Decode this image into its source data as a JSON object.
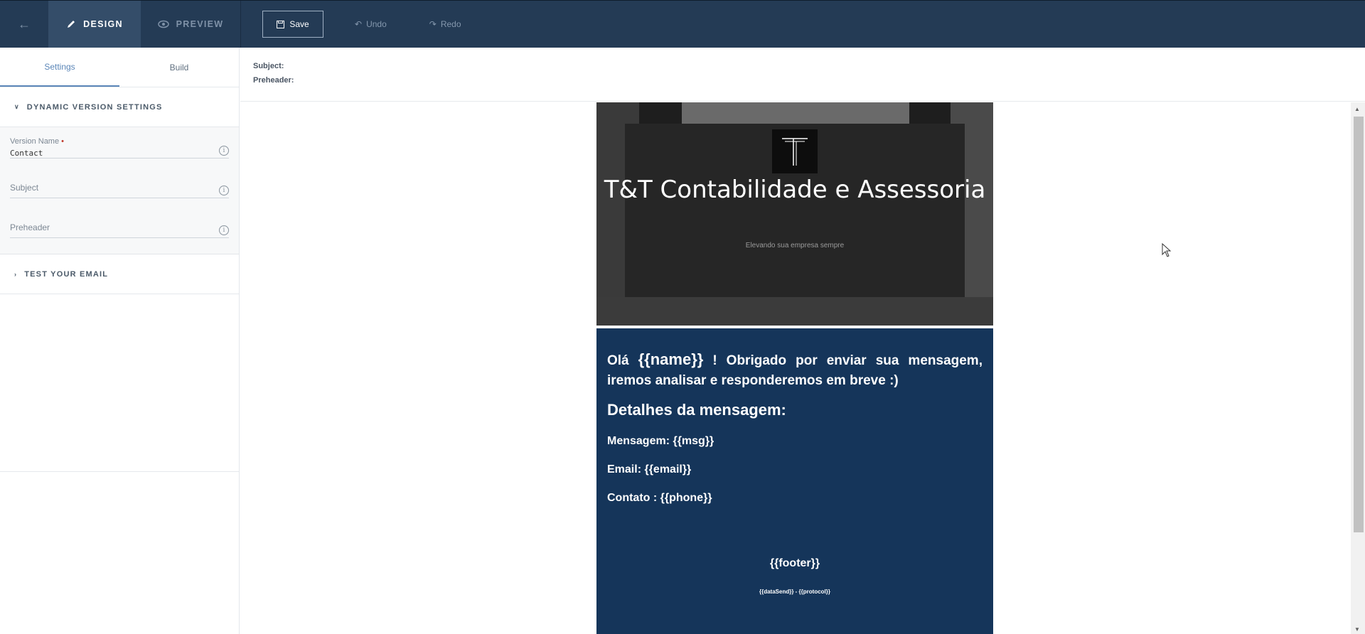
{
  "topbar": {
    "back_icon": "arrow-left-icon",
    "tab_design": "DESIGN",
    "tab_preview": "PREVIEW",
    "save_label": "Save",
    "undo_label": "Undo",
    "redo_label": "Redo"
  },
  "sidebar": {
    "tabs": [
      "Settings",
      "Build"
    ],
    "panel_dynamic": "DYNAMIC VERSION SETTINGS",
    "fields": {
      "version_name_label": "Version Name",
      "version_name_value": "Contact",
      "subject_label": "Subject",
      "preheader_label": "Preheader"
    },
    "panel_test": "TEST YOUR EMAIL"
  },
  "meta": {
    "subject_label": "Subject:",
    "preheader_label": "Preheader:"
  },
  "email": {
    "hero_title": "T&T Contabilidade e Assessoria",
    "hero_subtitle": "Elevando sua empresa sempre",
    "intro_prefix": "Olá ",
    "intro_name": "{{name}}",
    "intro_rest": " ! Obrigado por enviar sua mensagem, iremos analisar e responderemos em breve  :)",
    "details_heading": "Detalhes da mensagem:",
    "message_line": "Mensagem: {{msg}}",
    "email_line": "Email: {{email}}",
    "contact_line": "Contato : {{phone}}",
    "footer": "{{footer}}",
    "date_protocol": "{{dataSend}} - {{protocol}}"
  },
  "colors": {
    "topbar_bg": "#243b55",
    "active_tab_bg": "#344d69",
    "accent": "#5b86b8",
    "email_content_bg": "#15355a"
  }
}
